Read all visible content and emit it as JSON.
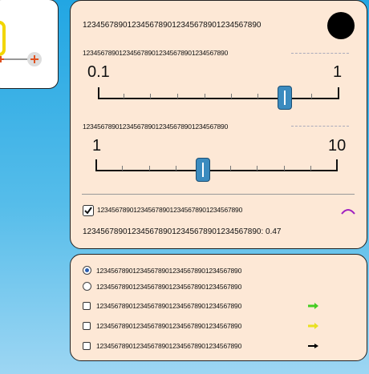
{
  "top_panel": {
    "title": "1234567890123456789012345678901234567890",
    "color_swatch": "#000000",
    "slider1": {
      "label": "1234567890123456789012345678901234567890",
      "min": "0.1",
      "max": "1",
      "value": 0.8
    },
    "slider2": {
      "label": "1234567890123456789012345678901234567890",
      "min": "1",
      "max": "10",
      "value": 5
    },
    "checkbox": {
      "label": "1234567890123456789012345678901234567890",
      "checked": true,
      "icon": "arc-icon"
    },
    "value_line": "1234567890123456789012345678901234567890: 0.47"
  },
  "bottom_panel": {
    "radio1": {
      "label": "1234567890123456789012345678901234567890",
      "selected": true
    },
    "radio2": {
      "label": "1234567890123456789012345678901234567890",
      "selected": false
    },
    "arrows": [
      {
        "label": "1234567890123456789012345678901234567890",
        "icon": "green-arrow-icon",
        "color": "#44cc22"
      },
      {
        "label": "1234567890123456789012345678901234567890",
        "icon": "yellow-arrow-icon",
        "color": "#e8e020"
      },
      {
        "label": "1234567890123456789012345678901234567890",
        "icon": "black-arrow-icon",
        "color": "#000000"
      }
    ]
  },
  "colors": {
    "panel_bg": "#fde8d6",
    "thumb": "#3b8bbf",
    "background_top": "#22a6e3"
  }
}
